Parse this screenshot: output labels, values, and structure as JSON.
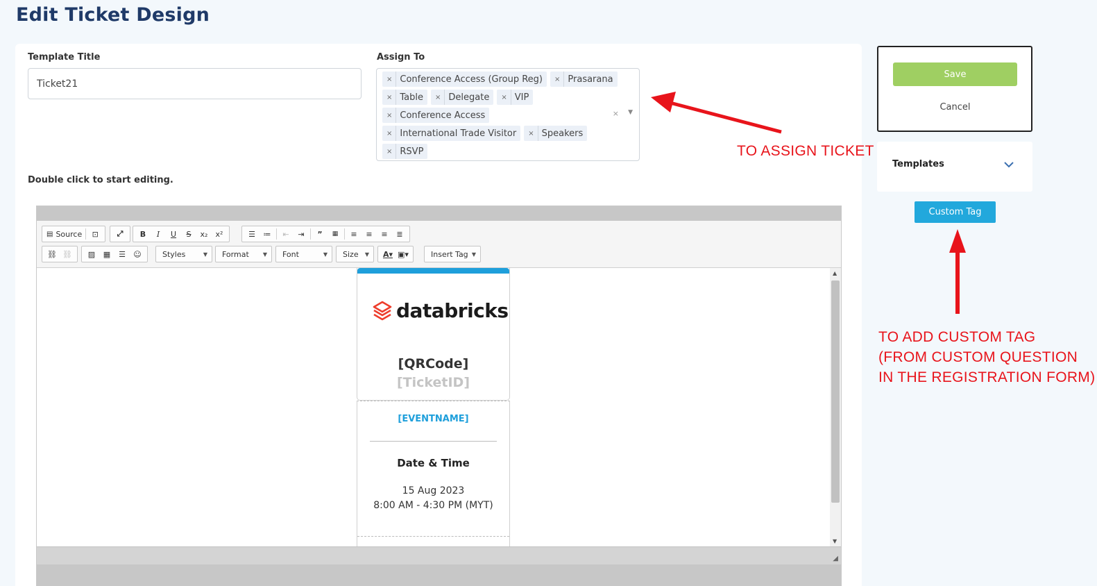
{
  "page": {
    "title": "Edit Ticket Design"
  },
  "form": {
    "template_title_label": "Template Title",
    "template_title_value": "Ticket21",
    "assign_to_label": "Assign To",
    "assign_tags": [
      "Conference Access (Group Reg)",
      "Prasarana",
      "Table",
      "Delegate",
      "VIP",
      "Conference Access",
      "International Trade Visitor",
      "Speakers",
      "RSVP"
    ],
    "hint": "Double click to start editing."
  },
  "toolbar": {
    "source_label": "Source",
    "styles_label": "Styles",
    "format_label": "Format",
    "font_label": "Font",
    "size_label": "Size",
    "insert_tag_label": "Insert Tag"
  },
  "ticket": {
    "logo_text": "databricks",
    "qr_placeholder": "[QRCode]",
    "ticket_id_placeholder": "[TicketID]",
    "event_name_placeholder": "[EVENTNAME]",
    "date_time_heading": "Date & Time",
    "date": "15 Aug 2023",
    "time": "8:00 AM - 4:30 PM (MYT)",
    "accent_color": "#1e9fdb"
  },
  "sidebar": {
    "save_label": "Save",
    "cancel_label": "Cancel",
    "templates_label": "Templates",
    "custom_tag_label": "Custom Tag"
  },
  "annotations": {
    "assign_note": "TO ASSIGN TICKET",
    "custom_tag_note_1": "TO ADD CUSTOM TAG",
    "custom_tag_note_2": "(FROM CUSTOM QUESTION",
    "custom_tag_note_3": "IN THE REGISTRATION FORM)",
    "color": "#e8141b"
  }
}
